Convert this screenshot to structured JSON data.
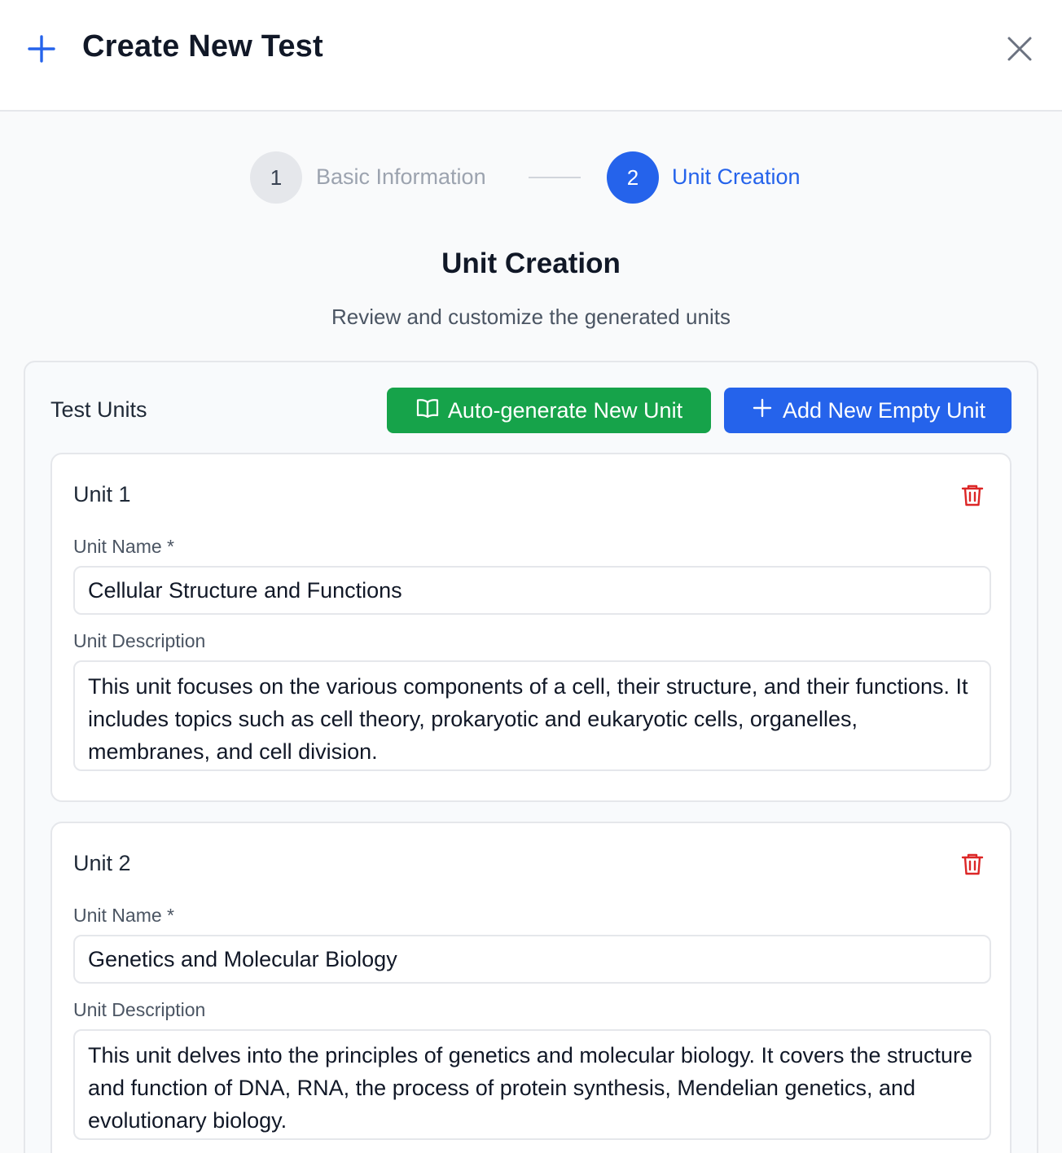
{
  "dialog": {
    "title": "Create New Test",
    "icons": {
      "title": "plus-icon",
      "close": "close-icon"
    },
    "accent_color": "#2563eb"
  },
  "stepper": {
    "steps": [
      {
        "number": "1",
        "label": "Basic Information",
        "state": "completed-inactive"
      },
      {
        "number": "2",
        "label": "Unit Creation",
        "state": "active"
      }
    ]
  },
  "section": {
    "title": "Unit Creation",
    "subtitle": "Review and customize the generated units"
  },
  "units_panel": {
    "heading": "Test Units",
    "auto_generate_button": {
      "label": "Auto-generate New Unit",
      "icon": "book-open-icon",
      "color": "#16a34a"
    },
    "add_empty_button": {
      "label": "Add New Empty Unit",
      "icon": "plus-icon",
      "color": "#2563eb"
    },
    "name_label": "Unit Name *",
    "description_label": "Unit Description",
    "units": [
      {
        "title": "Unit 1",
        "name": "Cellular Structure and Functions",
        "description": "This unit focuses on the various components of a cell, their structure, and their functions. It includes topics such as cell theory, prokaryotic and eukaryotic cells, organelles, membranes, and cell division."
      },
      {
        "title": "Unit 2",
        "name": "Genetics and Molecular Biology",
        "description": "This unit delves into the principles of genetics and molecular biology. It covers the structure and function of DNA, RNA, the process of protein synthesis, Mendelian genetics, and evolutionary biology."
      }
    ],
    "delete_icon": "trash-icon",
    "delete_color": "#dc2626"
  }
}
